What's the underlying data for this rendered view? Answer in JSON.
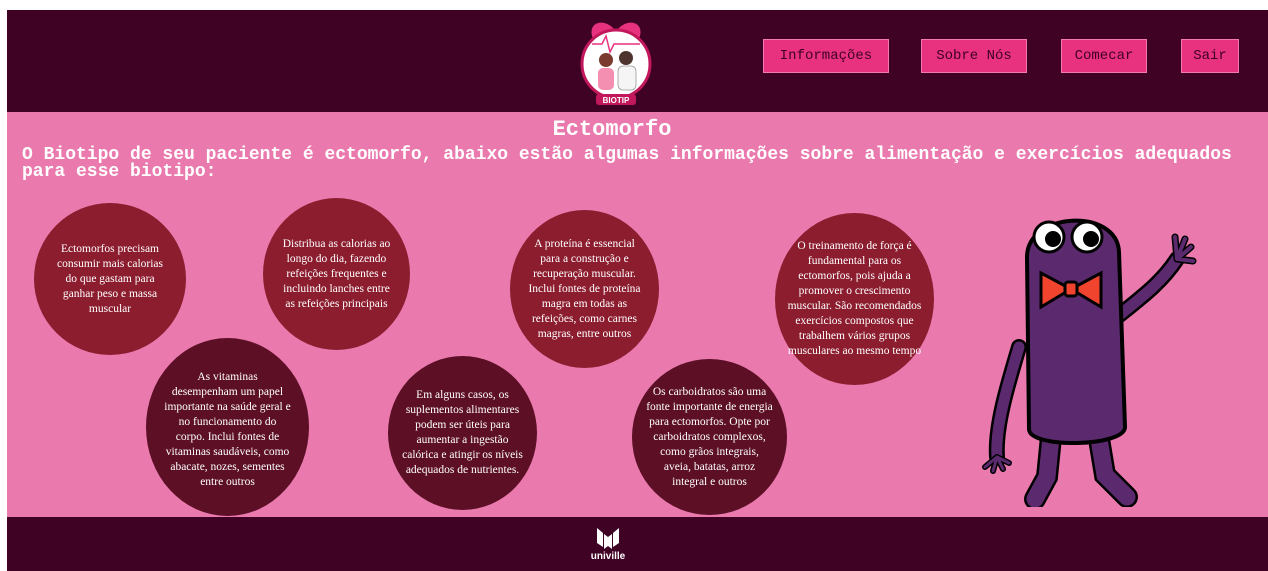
{
  "colors": {
    "header_bg": "#3f0224",
    "main_bg": "#ea7aae",
    "button_bg": "#e8317f",
    "circle_red": "#8c1d2f",
    "circle_dark": "#5c0f25"
  },
  "header": {
    "logo_text": "BIOTIP",
    "nav": [
      {
        "label": "Informações"
      },
      {
        "label": "Sobre Nós"
      },
      {
        "label": "Comecar"
      },
      {
        "label": "Sair"
      }
    ]
  },
  "main": {
    "title": "Ectomorfo",
    "subtitle": "O Biotipo de seu paciente é ectomorfo, abaixo estão algumas informações sobre alimentação e exercícios adequados para esse biotipo:",
    "cards": [
      {
        "text": "Ectomorfos precisam consumir mais calorias do que gastam para ganhar peso e massa muscular"
      },
      {
        "text": "As vitaminas desempenham um papel importante na saúde geral e no funcionamento do corpo. Inclui fontes de vitaminas saudáveis, como abacate, nozes, sementes entre outros"
      },
      {
        "text": "Distribua as calorias ao longo do dia, fazendo refeições frequentes e incluindo lanches entre as refeições principais"
      },
      {
        "text": "Em alguns casos, os suplementos alimentares podem ser úteis para aumentar a ingestão calórica e atingir os níveis adequados de nutrientes."
      },
      {
        "text": "A proteína é essencial para a construção e recuperação muscular. Inclui fontes de proteína magra em todas as refeições, como carnes magras, entre outros"
      },
      {
        "text": "Os carboidratos são uma fonte importante de energia para ectomorfos. Opte por carboidratos complexos, como grãos integrais, aveia, batatas, arroz integral e outros"
      },
      {
        "text": "O treinamento de força é fundamental para os ectomorfos, pois ajuda a promover o crescimento muscular. São recomendados exercícios compostos que trabalhem vários grupos musculares ao mesmo tempo"
      }
    ]
  },
  "footer": {
    "brand": "univille"
  },
  "icons": {
    "logo": "doctor-patient-logo",
    "mascot": "purple-bowtie-mascot",
    "footer_logo": "univille-logo"
  }
}
